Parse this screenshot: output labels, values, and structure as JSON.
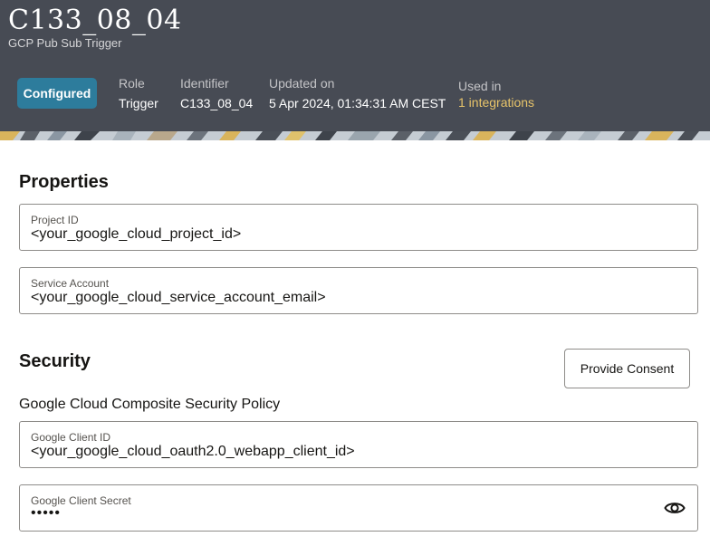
{
  "header": {
    "title": "C133_08_04",
    "subtitle": "GCP Pub Sub Trigger",
    "status_badge": "Configured",
    "role_label": "Role",
    "role_value": "Trigger",
    "identifier_label": "Identifier",
    "identifier_value": "C133_08_04",
    "updated_label": "Updated on",
    "updated_value": "5 Apr 2024, 01:34:31 AM CEST",
    "used_label": "Used in",
    "used_value": "1 integrations"
  },
  "properties": {
    "heading": "Properties",
    "project_id": {
      "label": "Project ID",
      "value": "<your_google_cloud_project_id>"
    },
    "service_account": {
      "label": "Service Account",
      "value": "<your_google_cloud_service_account_email>"
    }
  },
  "security": {
    "heading": "Security",
    "consent_button": "Provide Consent",
    "policy": "Google Cloud Composite Security Policy",
    "client_id": {
      "label": "Google Client ID",
      "value": "<your_google_cloud_oauth2.0_webapp_client_id>"
    },
    "client_secret": {
      "label": "Google Client Secret",
      "value": "•••••",
      "icon": "eye-icon"
    }
  },
  "colors": {
    "header_bg": "#474b54",
    "badge_bg": "#2d7c9c",
    "link": "#e8c46a"
  }
}
